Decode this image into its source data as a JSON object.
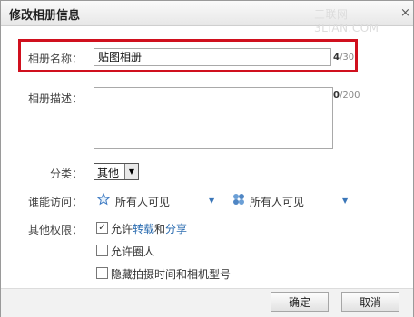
{
  "dialog": {
    "title": "修改相册信息",
    "watermark": "三联网 3LIAN.COM",
    "close_glyph": "×"
  },
  "form": {
    "name_label": "相册名称：",
    "name_value": "贴图相册",
    "name_count_current": "4",
    "name_count_max": "/30",
    "desc_label": "相册描述：",
    "desc_value": "",
    "desc_count_current": "0",
    "desc_count_max": "/200",
    "category_label": "分类：",
    "category_value": "其他",
    "access_label": "谁能访问：",
    "access_options": [
      {
        "label": "所有人可见",
        "icon": "star-icon"
      },
      {
        "label": "所有人可见",
        "icon": "puzzle-icon"
      }
    ],
    "perm_label": "其他权限：",
    "permissions": [
      {
        "prefix": "允许",
        "link1": "转载",
        "mid": "和",
        "link2": "分享",
        "checked": true
      },
      {
        "text": "允许圈人",
        "checked": false
      },
      {
        "text": "隐藏拍摄时间和相机型号",
        "checked": false
      }
    ]
  },
  "buttons": {
    "ok": "确定",
    "cancel": "取消"
  },
  "colors": {
    "highlight_border": "#d0101e",
    "link": "#2b6cb0"
  }
}
